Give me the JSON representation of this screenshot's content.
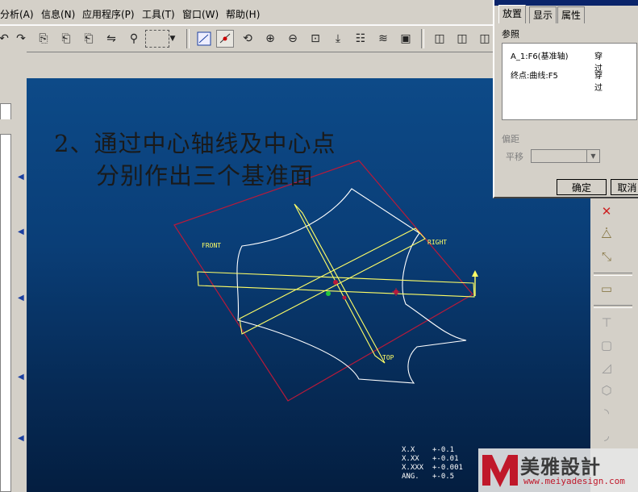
{
  "menu": [
    "分析(A)",
    "信息(N)",
    "应用程序(P)",
    "工具(T)",
    "窗口(W)",
    "帮助(H)"
  ],
  "dialog": {
    "tabs": [
      "放置",
      "显示",
      "属性"
    ],
    "references_label": "参照",
    "references": [
      {
        "item": "A_1:F6(基准轴)",
        "type": "穿过"
      },
      {
        "item": "终点:曲线:F5",
        "type": "穿过"
      }
    ],
    "offset_label": "偏距",
    "translate_label": "平移",
    "ok_label": "确定",
    "cancel_label": "取消"
  },
  "caption": {
    "line1": "2、通过中心轴线及中心点",
    "line2": "分别作出三个基准面"
  },
  "datum_labels": {
    "front": "FRONT",
    "right": "RIGHT",
    "top": "TOP"
  },
  "readout": [
    {
      "label": "X.X",
      "value": "+-0.1"
    },
    {
      "label": "X.XX",
      "value": "+-0.01"
    },
    {
      "label": "X.XXX",
      "value": "+-0.001"
    },
    {
      "label": "ANG.",
      "value": "+-0.5"
    }
  ],
  "watermark": {
    "brand": "美雅設計",
    "url": "www.meiyadesign.com"
  },
  "colors": {
    "canvas_top": "#0d4a88",
    "canvas_bottom": "#041e40",
    "datum": "#ffff66",
    "curve": "#ffffff",
    "box": "#b81a3a"
  }
}
